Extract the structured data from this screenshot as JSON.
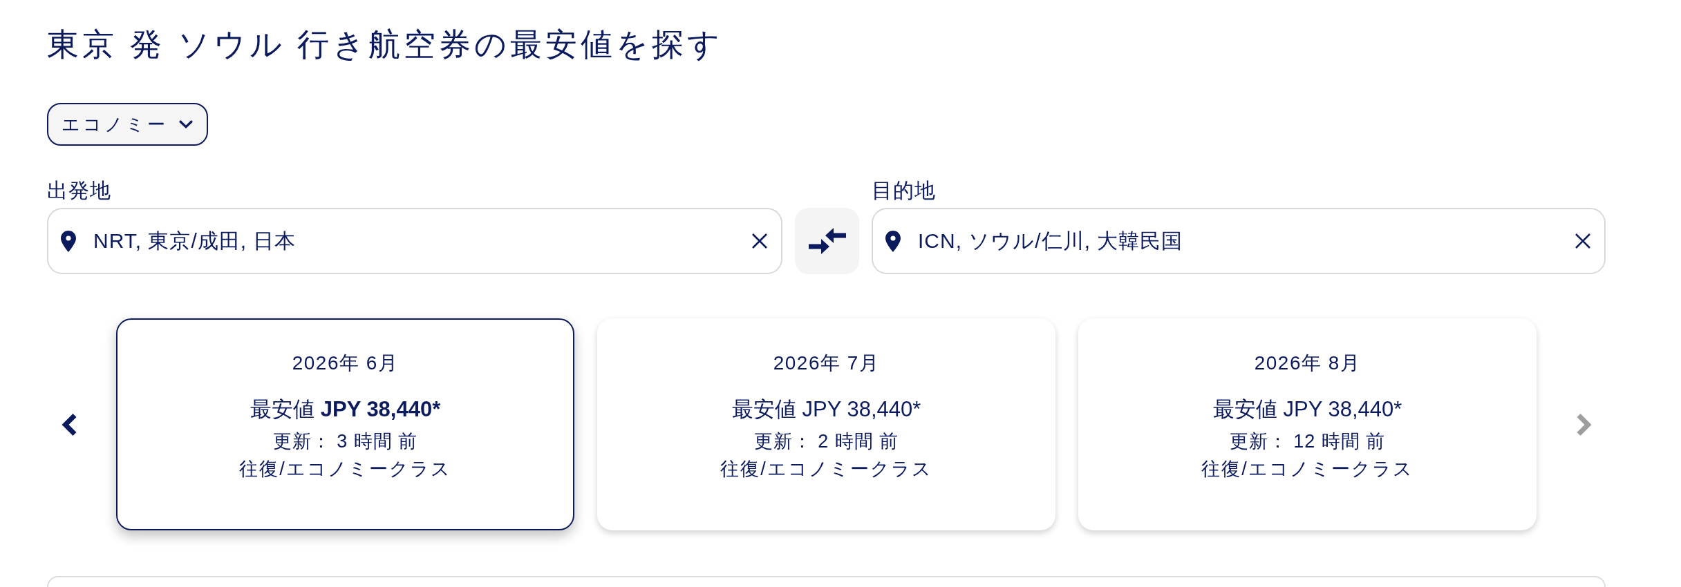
{
  "title": "東京 発 ソウル 行き航空券の最安値を探す",
  "cabin_dropdown": {
    "label": "エコノミー"
  },
  "origin": {
    "label": "出発地",
    "value": "NRT, 東京/成田, 日本"
  },
  "destination": {
    "label": "目的地",
    "value": "ICN, ソウル/仁川, 大韓民国"
  },
  "carousel": {
    "prev": {
      "disabled": false
    },
    "next": {
      "disabled": true
    },
    "months": [
      {
        "month": "2026年 6月",
        "price_label": "最安値",
        "price": "JPY 38,440*",
        "updated": "更新： 3 時間 前",
        "trip": "往復/エコノミークラス",
        "selected": true
      },
      {
        "month": "2026年 7月",
        "price_label": "最安値",
        "price": "JPY 38,440*",
        "updated": "更新： 2 時間 前",
        "trip": "往復/エコノミークラス",
        "selected": false
      },
      {
        "month": "2026年 8月",
        "price_label": "最安値",
        "price": "JPY 38,440*",
        "updated": "更新： 12 時間 前",
        "trip": "往復/エコノミークラス",
        "selected": false
      }
    ]
  }
}
